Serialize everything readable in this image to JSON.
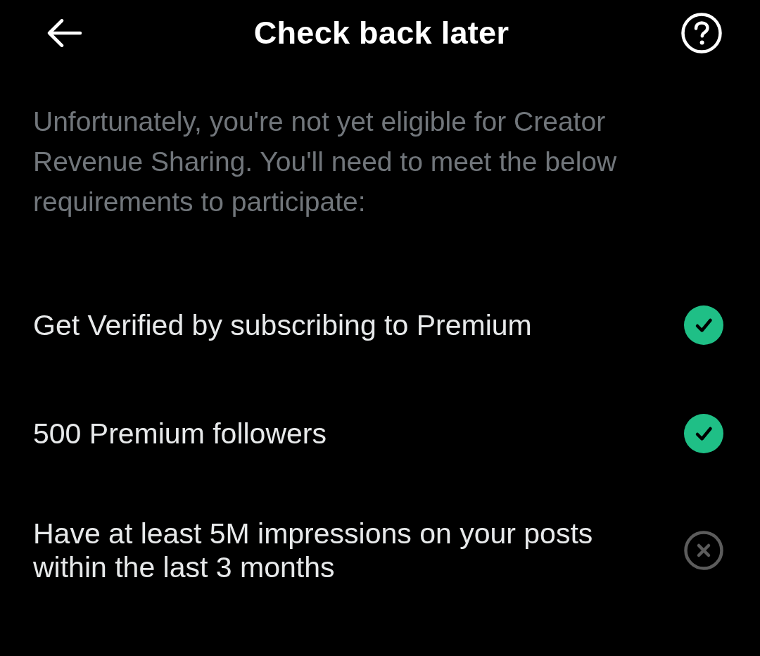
{
  "header": {
    "title": "Check back later"
  },
  "intro": "Unfortunately, you're not yet eligible for Creator Revenue Sharing. You'll need to meet the below requirements to participate:",
  "requirements": [
    {
      "text": "Get Verified by subscribing to Premium",
      "met": true
    },
    {
      "text": "500 Premium followers",
      "met": true
    },
    {
      "text": "Have at least 5M impressions on your posts within the last 3 months",
      "met": false
    }
  ]
}
